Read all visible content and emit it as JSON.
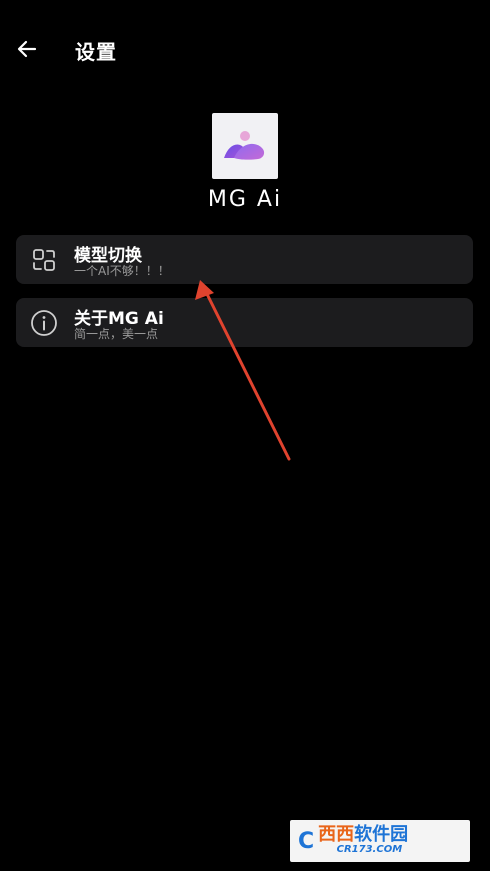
{
  "header": {
    "title": "设置",
    "back_icon": "arrow-left-icon"
  },
  "app": {
    "name": "MG Ai",
    "logo_icon": "mountain-logo-icon"
  },
  "settings": {
    "items": [
      {
        "title": "模型切换",
        "subtitle": "一个AI不够！！！",
        "icon": "switch-icon"
      },
      {
        "title": "关于MG Ai",
        "subtitle": "简一点，美一点",
        "icon": "info-icon"
      }
    ]
  },
  "watermark": {
    "logo": "C",
    "brand_part1": "西西",
    "brand_part2": "软件园",
    "domain": "CR173.COM"
  },
  "colors": {
    "background": "#000000",
    "card": "#1c1c1e",
    "annotation_arrow": "#e0432e",
    "subtitle_text": "#9a9a9a"
  }
}
